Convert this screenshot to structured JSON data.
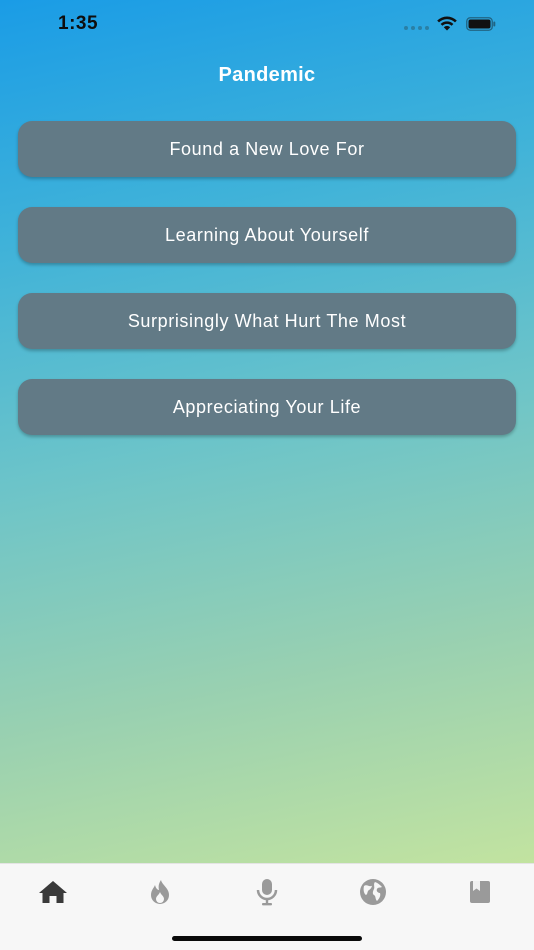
{
  "status_bar": {
    "time": "1:35",
    "icons": [
      "signal-icon",
      "wifi-icon",
      "battery-icon"
    ]
  },
  "screen": {
    "title": "Pandemic",
    "buttons": [
      {
        "label": "Found a New Love For"
      },
      {
        "label": "Learning About Yourself"
      },
      {
        "label": "Surprisingly What Hurt The Most"
      },
      {
        "label": "Appreciating Your Life"
      }
    ],
    "button_color": "#627a86"
  },
  "tab_bar": {
    "tabs": [
      {
        "icon": "home-icon",
        "active": true
      },
      {
        "icon": "flame-icon",
        "active": false
      },
      {
        "icon": "microphone-icon",
        "active": false
      },
      {
        "icon": "globe-icon",
        "active": false
      },
      {
        "icon": "book-icon",
        "active": false
      }
    ],
    "active_color": "#3a3a3a",
    "inactive_color": "#9a9a9a"
  }
}
